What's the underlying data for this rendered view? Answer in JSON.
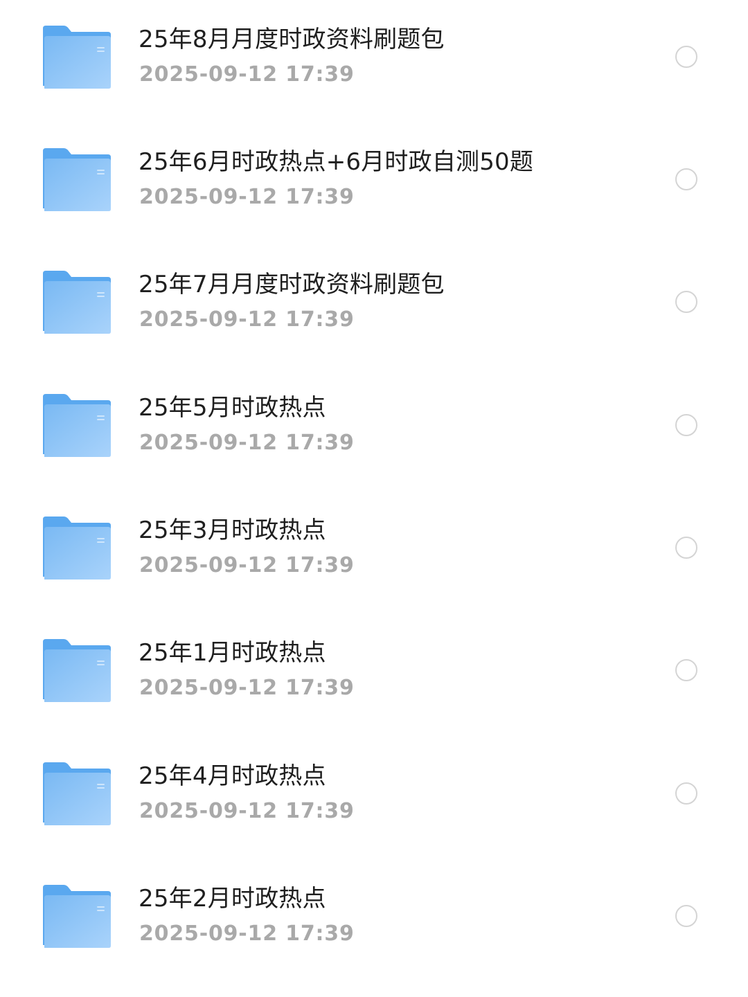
{
  "files": [
    {
      "name": "25年8月月度时政资料刷题包",
      "date": "2025-09-12 17:39",
      "icon": "folder-icon",
      "selected": false
    },
    {
      "name": "25年6月时政热点+6月时政自测50题",
      "date": "2025-09-12 17:39",
      "icon": "folder-icon",
      "selected": false
    },
    {
      "name": "25年7月月度时政资料刷题包",
      "date": "2025-09-12 17:39",
      "icon": "folder-icon",
      "selected": false
    },
    {
      "name": "25年5月时政热点",
      "date": "2025-09-12 17:39",
      "icon": "folder-icon",
      "selected": false
    },
    {
      "name": "25年3月时政热点",
      "date": "2025-09-12 17:39",
      "icon": "folder-icon",
      "selected": false
    },
    {
      "name": "25年1月时政热点",
      "date": "2025-09-12 17:39",
      "icon": "folder-icon",
      "selected": false
    },
    {
      "name": "25年4月时政热点",
      "date": "2025-09-12 17:39",
      "icon": "folder-icon",
      "selected": false
    },
    {
      "name": "25年2月时政热点",
      "date": "2025-09-12 17:39",
      "icon": "folder-icon",
      "selected": false
    }
  ],
  "colors": {
    "folder_back": "#5aa8ef",
    "folder_front_top": "#7ab9f3",
    "folder_front_bottom": "#a9d3fb",
    "title_text": "#1f1f1f",
    "date_text": "#a9a9a9",
    "select_border": "#d4d4d4"
  }
}
